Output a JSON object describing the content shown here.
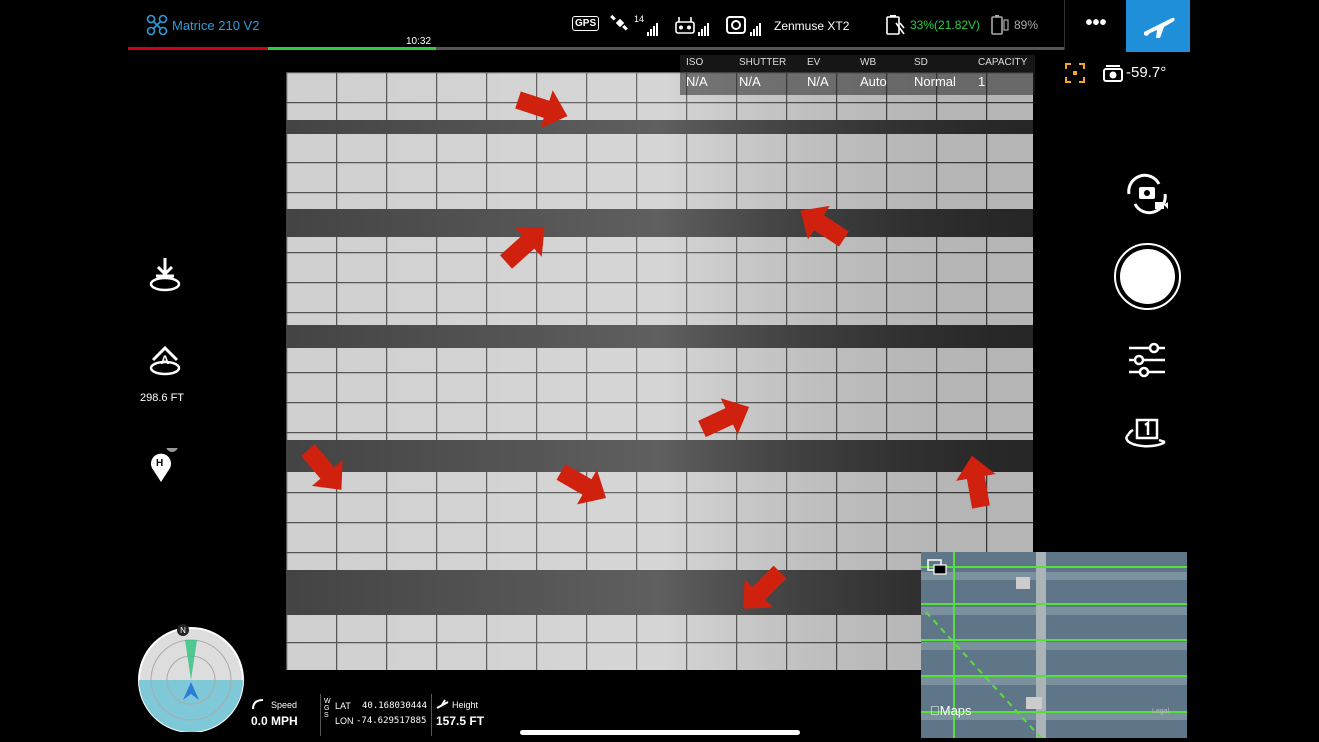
{
  "top_bar": {
    "aircraft_name": "Matrice 210 V2",
    "flight_time": "10:32",
    "gps_label": "GPS",
    "satellite_count": "14",
    "camera_name": "Zenmuse XT2",
    "battery": "33%(21.82V)",
    "rc_battery": "89%",
    "more_label": "•••"
  },
  "camera_params": {
    "iso_label": "ISO",
    "iso_value": "N/A",
    "shutter_label": "SHUTTER",
    "shutter_value": "N/A",
    "ev_label": "EV",
    "ev_value": "N/A",
    "wb_label": "WB",
    "wb_value": "Auto",
    "sd_label": "SD",
    "sd_value": "Normal",
    "capacity_label": "CAPACITY",
    "capacity_value": "1"
  },
  "gimbal": {
    "pitch": "-59.7°"
  },
  "left_panel": {
    "rth_distance": "298.6 FT",
    "home_marker": "H"
  },
  "compass": {
    "north_label": "N"
  },
  "telemetry": {
    "speed_label": "Speed",
    "speed_value": "0.0 MPH",
    "wgs_label": "WGS",
    "lat_label": "LAT",
    "lat_value": "40.168030444",
    "lon_label": "LON",
    "lon_value": "-74.629517885",
    "height_label": "Height",
    "height_value": "157.5 FT"
  },
  "minimap": {
    "maps_label": "Maps",
    "legal_label": "Legal"
  },
  "colors": {
    "accent_blue": "#2d9cdb",
    "battery_green": "#2ecc40",
    "arrow_red": "#d0210e",
    "exposure_orange": "#f5a623"
  }
}
